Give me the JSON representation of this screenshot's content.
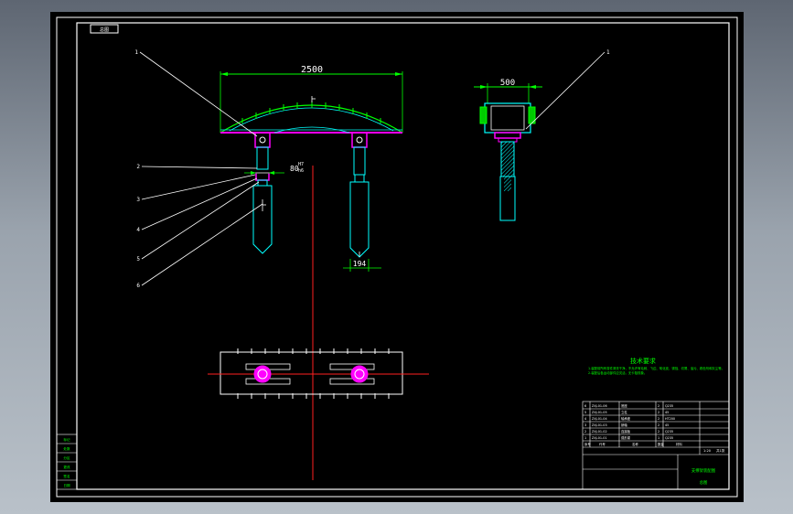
{
  "sheet": {
    "tag": "总图",
    "colors": {
      "frame": "#ffffff",
      "dim": "#00ff00",
      "part": "#00ffff",
      "accent": "#ff00ff",
      "center": "#ff2020"
    }
  },
  "front_view": {
    "dim_width": "2500",
    "dim_post_diameter": "80",
    "dim_post_tolerance_upper": "H7",
    "dim_post_tolerance_lower": "h6",
    "dim_foot": "194",
    "leaders": [
      "1",
      "2",
      "3",
      "4",
      "5",
      "6"
    ]
  },
  "side_view": {
    "dim_width": "500",
    "leaders": [
      "1"
    ]
  },
  "notes": {
    "title": "技术要求",
    "line1": "1.装配前所有零件清洗干净，不允许有毛刺、飞边、氧化皮、锈蚀、切屑、油污、着色剂和灰尘等。",
    "line2": "2.装配后各运动部件应灵活，无卡阻现象。"
  },
  "title_block": {
    "bom_rows": [
      [
        "6",
        "ZXJ-01-06",
        "底座",
        "2",
        "Q235"
      ],
      [
        "5",
        "ZXJ-01-05",
        "立柱",
        "2",
        "45"
      ],
      [
        "4",
        "ZXJ-01-04",
        "轴承座",
        "2",
        "HT200"
      ],
      [
        "3",
        "ZXJ-01-03",
        "销轴",
        "2",
        "45"
      ],
      [
        "2",
        "ZXJ-01-02",
        "连接板",
        "2",
        "Q235"
      ],
      [
        "1",
        "ZXJ-01-01",
        "弧形梁",
        "1",
        "Q235"
      ]
    ],
    "header": [
      "序号",
      "代号",
      "名称",
      "数量",
      "材料"
    ],
    "drawing_name": "支撑架装配图",
    "drawing_no": "总图",
    "scale": "1:20",
    "sheet": "共1张"
  },
  "left_strip": [
    "标记",
    "处数",
    "分区",
    "更改",
    "签名",
    "日期"
  ]
}
